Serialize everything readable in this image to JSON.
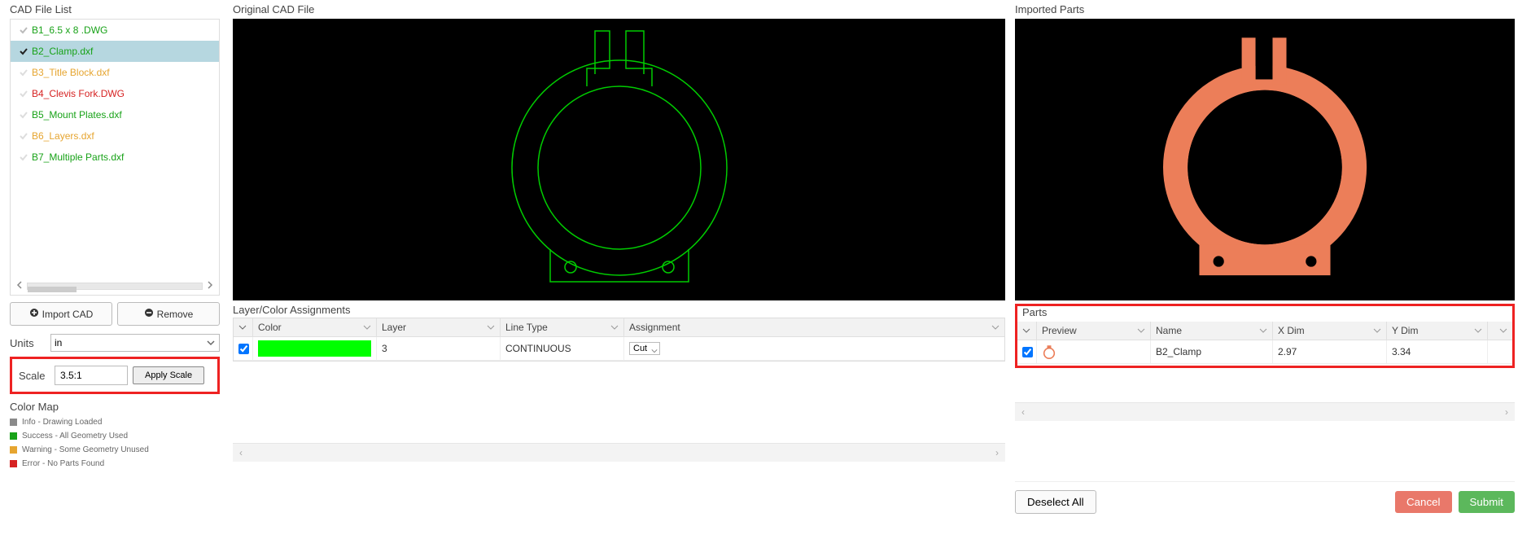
{
  "sidebar": {
    "title": "CAD File List",
    "files": [
      {
        "name": "B1_6.5 x 8 .DWG",
        "color": "#18a218",
        "selected": false,
        "checked": true,
        "checkColor": "#bbb"
      },
      {
        "name": "B2_Clamp.dxf",
        "color": "#18a218",
        "selected": true,
        "checked": true,
        "checkColor": "#222"
      },
      {
        "name": "B3_Title Block.dxf",
        "color": "#e6a530",
        "selected": false,
        "checked": true,
        "checkColor": "#ddd"
      },
      {
        "name": "B4_Clevis Fork.DWG",
        "color": "#d62222",
        "selected": false,
        "checked": false,
        "checkColor": "#ddd"
      },
      {
        "name": "B5_Mount Plates.dxf",
        "color": "#18a218",
        "selected": false,
        "checked": true,
        "checkColor": "#ddd"
      },
      {
        "name": "B6_Layers.dxf",
        "color": "#e6a530",
        "selected": false,
        "checked": true,
        "checkColor": "#ddd"
      },
      {
        "name": "B7_Multiple Parts.dxf",
        "color": "#18a218",
        "selected": false,
        "checked": true,
        "checkColor": "#ddd"
      }
    ],
    "import_label": "Import CAD",
    "remove_label": "Remove",
    "units_label": "Units",
    "units_value": "in",
    "scale_label": "Scale",
    "scale_value": "3.5:1",
    "apply_label": "Apply Scale",
    "colormap_title": "Color Map",
    "colormap": [
      {
        "color": "#8a8a8a",
        "label": "Info - Drawing Loaded"
      },
      {
        "color": "#18a218",
        "label": "Success - All Geometry Used"
      },
      {
        "color": "#e6a530",
        "label": "Warning - Some Geometry Unused"
      },
      {
        "color": "#d62222",
        "label": "Error - No Parts Found"
      }
    ]
  },
  "center": {
    "title": "Original CAD File",
    "layer_title": "Layer/Color Assignments",
    "headers": {
      "color": "Color",
      "layer": "Layer",
      "linetype": "Line Type",
      "assignment": "Assignment"
    },
    "row": {
      "layer": "3",
      "linetype": "CONTINUOUS",
      "assignment": "Cut",
      "swatch": "#00ff00"
    }
  },
  "right": {
    "title": "Imported Parts",
    "parts_title": "Parts",
    "headers": {
      "preview": "Preview",
      "name": "Name",
      "xdim": "X Dim",
      "ydim": "Y Dim"
    },
    "row": {
      "name": "B2_Clamp",
      "xdim": "2.97",
      "ydim": "3.34"
    },
    "deselect": "Deselect All",
    "cancel": "Cancel",
    "submit": "Submit"
  }
}
